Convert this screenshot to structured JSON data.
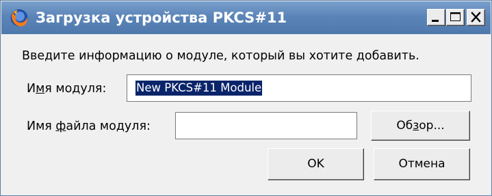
{
  "window": {
    "title": "Загрузка устройства PKCS#11",
    "controls": {
      "minimize": "minimize-icon",
      "maximize": "maximize-icon",
      "close": "close-icon"
    }
  },
  "dialog": {
    "instruction": "Введите информацию о модуле, который вы хотите добавить.",
    "module_name": {
      "label_pre": "И",
      "label_mnemonic": "м",
      "label_post": "я модуля:",
      "value": "New PKCS#11 Module"
    },
    "module_file": {
      "label_pre": "Имя ",
      "label_mnemonic": "ф",
      "label_post": "айла модуля:",
      "value": ""
    },
    "buttons": {
      "browse_pre": "Об",
      "browse_mnemonic": "з",
      "browse_post": "ор...",
      "ok": "OK",
      "cancel": "Отмена"
    }
  },
  "colors": {
    "titlebar": "#5b85b8",
    "title_text": "#ffffff",
    "dialog_bg": "#f0f0f0",
    "selection": "#0a246a"
  }
}
